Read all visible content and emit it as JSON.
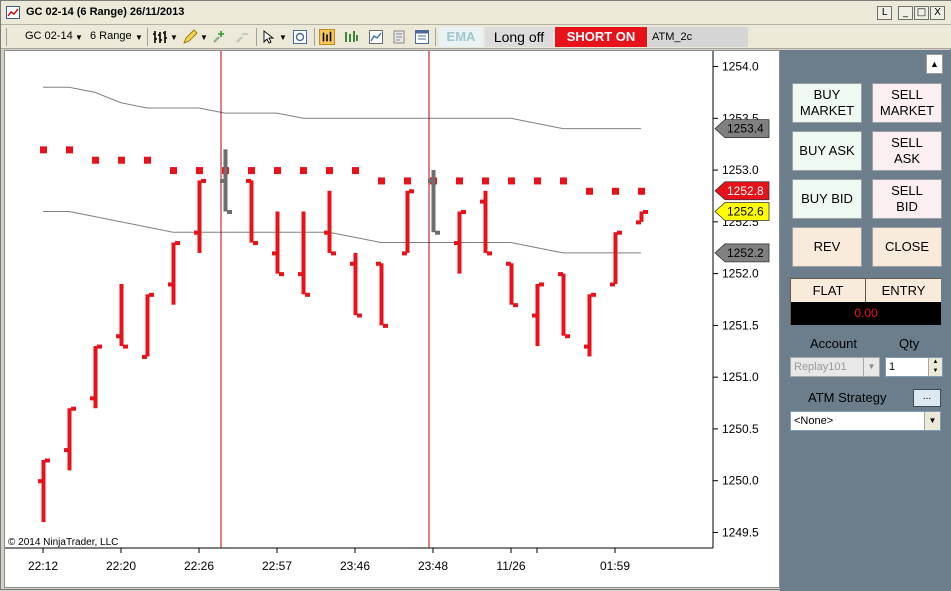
{
  "window": {
    "title": "GC 02-14 (6 Range)  26/11/2013",
    "controls": [
      "L",
      "_",
      "□",
      "X"
    ]
  },
  "toolbar": {
    "instrument": "GC 02-14",
    "period": "6 Range",
    "ema_label": "EMA",
    "long_label": "Long off",
    "short_label": "SHORT ON",
    "atm_field": "ATM_2c",
    "colors": {
      "short_bg": "#e8121b",
      "ema_fg": "#9fc6c8"
    }
  },
  "chart": {
    "copyright": "© 2014 NinjaTrader, LLC",
    "y_ticks": [
      "1254.0",
      "1253.5",
      "1253.0",
      "1252.5",
      "1252.0",
      "1251.5",
      "1251.0",
      "1250.5",
      "1250.0",
      "1249.5"
    ],
    "x_ticks": [
      "22:12",
      "22:20",
      "22:26",
      "22:57",
      "23:46",
      "23:48",
      "11/26",
      "01:59"
    ],
    "price_markers": [
      {
        "value": "1253.4",
        "bg": "#808080",
        "fg": "#000000"
      },
      {
        "value": "1252.8",
        "bg": "#e8121b",
        "fg": "#ffffff"
      },
      {
        "value": "1252.6",
        "bg": "#ffff00",
        "fg": "#000000"
      },
      {
        "value": "1252.2",
        "bg": "#808080",
        "fg": "#000000"
      }
    ]
  },
  "chart_data": {
    "type": "ohlc",
    "ylim": [
      1249.35,
      1254.15
    ],
    "colors": {
      "bar": "#e8121b",
      "bar_highlight": "#6e6e6e",
      "channel": "#808080",
      "vline": "#c00000"
    },
    "bars": [
      {
        "o": 1250.0,
        "h": 1250.2,
        "l": 1249.6,
        "c": 1250.2
      },
      {
        "o": 1250.3,
        "h": 1250.7,
        "l": 1250.1,
        "c": 1250.7
      },
      {
        "o": 1250.8,
        "h": 1251.3,
        "l": 1250.7,
        "c": 1251.3
      },
      {
        "o": 1251.4,
        "h": 1251.9,
        "l": 1251.3,
        "c": 1251.3
      },
      {
        "o": 1251.2,
        "h": 1251.8,
        "l": 1251.2,
        "c": 1251.8
      },
      {
        "o": 1251.9,
        "h": 1252.3,
        "l": 1251.7,
        "c": 1252.3
      },
      {
        "o": 1252.4,
        "h": 1252.9,
        "l": 1252.2,
        "c": 1252.9
      },
      {
        "o": 1252.9,
        "h": 1253.2,
        "l": 1252.6,
        "c": 1252.6,
        "hl": true
      },
      {
        "o": 1252.9,
        "h": 1252.9,
        "l": 1252.3,
        "c": 1252.3
      },
      {
        "o": 1252.2,
        "h": 1252.6,
        "l": 1252.0,
        "c": 1252.0
      },
      {
        "o": 1252.0,
        "h": 1252.6,
        "l": 1251.8,
        "c": 1251.8
      },
      {
        "o": 1252.4,
        "h": 1252.8,
        "l": 1252.2,
        "c": 1252.2
      },
      {
        "o": 1252.1,
        "h": 1252.2,
        "l": 1251.6,
        "c": 1251.6
      },
      {
        "o": 1252.1,
        "h": 1252.1,
        "l": 1251.5,
        "c": 1251.5
      },
      {
        "o": 1252.2,
        "h": 1252.8,
        "l": 1252.2,
        "c": 1252.8
      },
      {
        "o": 1252.9,
        "h": 1253.0,
        "l": 1252.4,
        "c": 1252.4,
        "hl": true
      },
      {
        "o": 1252.3,
        "h": 1252.6,
        "l": 1252.0,
        "c": 1252.6
      },
      {
        "o": 1252.7,
        "h": 1252.8,
        "l": 1252.2,
        "c": 1252.2
      },
      {
        "o": 1252.1,
        "h": 1252.1,
        "l": 1251.7,
        "c": 1251.7
      },
      {
        "o": 1251.6,
        "h": 1251.9,
        "l": 1251.3,
        "c": 1251.9
      },
      {
        "o": 1252.0,
        "h": 1252.0,
        "l": 1251.4,
        "c": 1251.4
      },
      {
        "o": 1251.3,
        "h": 1251.8,
        "l": 1251.2,
        "c": 1251.8
      },
      {
        "o": 1251.9,
        "h": 1252.4,
        "l": 1251.9,
        "c": 1252.4
      },
      {
        "o": 1252.5,
        "h": 1252.6,
        "l": 1252.5,
        "c": 1252.6
      }
    ],
    "dots": [
      1253.2,
      1253.2,
      1253.1,
      1253.1,
      1253.1,
      1253.0,
      1253.0,
      1253.0,
      1253.0,
      1253.0,
      1253.0,
      1253.0,
      1253.0,
      1252.9,
      1252.9,
      1252.9,
      1252.9,
      1252.9,
      1252.9,
      1252.9,
      1252.9,
      1252.8,
      1252.8,
      1252.8
    ],
    "upper_channel": [
      1253.8,
      1253.8,
      1253.75,
      1253.65,
      1253.6,
      1253.6,
      1253.6,
      1253.55,
      1253.55,
      1253.55,
      1253.5,
      1253.5,
      1253.5,
      1253.5,
      1253.5,
      1253.5,
      1253.5,
      1253.5,
      1253.5,
      1253.45,
      1253.4,
      1253.4,
      1253.4,
      1253.4
    ],
    "lower_channel": [
      1252.6,
      1252.6,
      1252.55,
      1252.5,
      1252.45,
      1252.4,
      1252.4,
      1252.4,
      1252.4,
      1252.4,
      1252.4,
      1252.4,
      1252.35,
      1252.3,
      1252.3,
      1252.3,
      1252.3,
      1252.3,
      1252.3,
      1252.25,
      1252.2,
      1252.2,
      1252.2,
      1252.2
    ],
    "vlines_at_bar": [
      7,
      15
    ]
  },
  "panel": {
    "buy_market": "BUY\nMARKET",
    "sell_market": "SELL\nMARKET",
    "buy_ask": "BUY ASK",
    "sell_ask": "SELL\nASK",
    "buy_bid": "BUY BID",
    "sell_bid": "SELL\nBID",
    "rev": "REV",
    "close": "CLOSE",
    "position": "FLAT",
    "entry": "ENTRY",
    "pnl": "0.00",
    "account_label": "Account",
    "qty_label": "Qty",
    "account_value": "Replay101",
    "qty_value": "1",
    "atm_label": "ATM Strategy",
    "atm_btn": "...",
    "atm_value": "<None>"
  }
}
